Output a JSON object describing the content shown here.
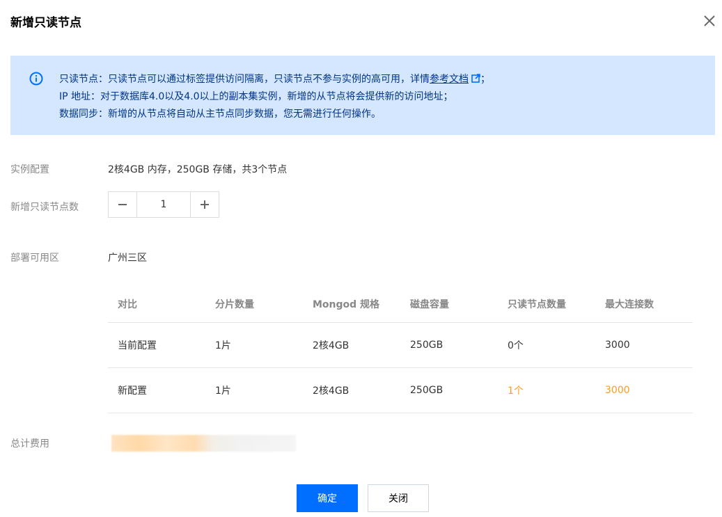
{
  "dialog": {
    "title": "新增只读节点"
  },
  "notice": {
    "line1_prefix": "只读节点：只读节点可以通过标签提供访问隔离，只读节点不参与实例的高可用，详情",
    "line1_link": "参考文档",
    "line1_suffix": "；",
    "line2": "IP 地址：对于数据库4.0以及4.0以上的副本集实例，新增的从节点将会提供新的访问地址；",
    "line3": "数据同步：新增的从节点将自动从主节点同步数据，您无需进行任何操作。"
  },
  "form": {
    "instance_config_label": "实例配置",
    "instance_config_value": "2核4GB 内存，250GB 存储，共3个节点",
    "readonly_count_label": "新增只读节点数",
    "readonly_count_value": "1",
    "zone_label": "部署可用区",
    "zone_value": "广州三区",
    "total_cost_label": "总计费用"
  },
  "table": {
    "headers": [
      "对比",
      "分片数量",
      "Mongod 规格",
      "磁盘容量",
      "只读节点数量",
      "最大连接数"
    ],
    "rows": [
      [
        "当前配置",
        "1片",
        "2核4GB",
        "250GB",
        "0个",
        "3000"
      ],
      [
        "新配置",
        "1片",
        "2核4GB",
        "250GB",
        "1个",
        "3000"
      ]
    ]
  },
  "buttons": {
    "confirm": "确定",
    "close": "关闭"
  },
  "colors": {
    "primary": "#006eff",
    "notice_bg": "#d5e7ff",
    "notice_text": "#003585",
    "highlight": "#ff9c19"
  }
}
